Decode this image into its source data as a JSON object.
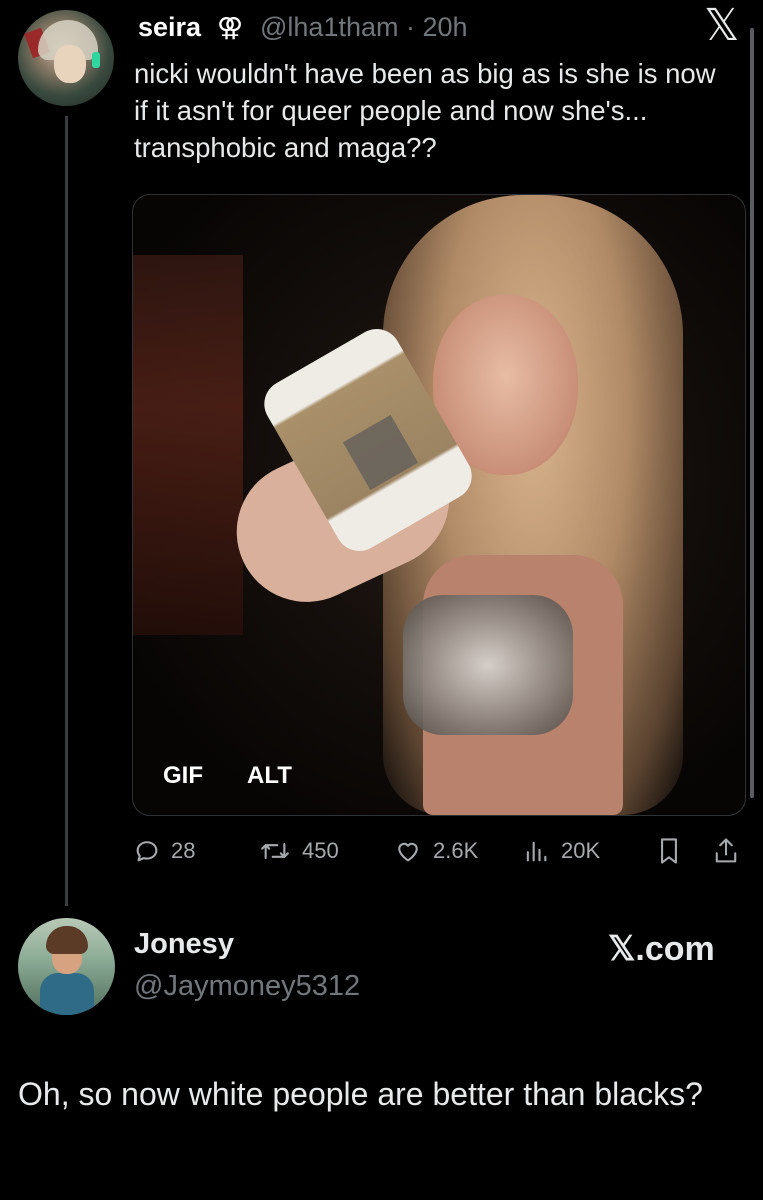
{
  "tweet": {
    "author": {
      "name": "seira",
      "symbol": "⚢",
      "handle": "@lha1tham",
      "time": "20h",
      "handle_time": "@lha1tham · 20h"
    },
    "text": "nicki wouldn't have been as big as is she is now if it asn't for queer people and now she's... transphobic and maga??",
    "media": {
      "badges": [
        "GIF",
        "ALT"
      ]
    },
    "actions": {
      "replies": "28",
      "retweets": "450",
      "likes": "2.6K",
      "views": "20K"
    },
    "brand_icon": "x-logo-icon"
  },
  "reply": {
    "name": "Jonesy",
    "handle": "@Jaymoney5312",
    "watermark": "𝕏.com",
    "text": "Oh, so now white people are better than blacks?"
  },
  "colors": {
    "background": "#000000",
    "text": "#e7e9ea",
    "muted": "#71767b",
    "border": "#2f3336"
  }
}
